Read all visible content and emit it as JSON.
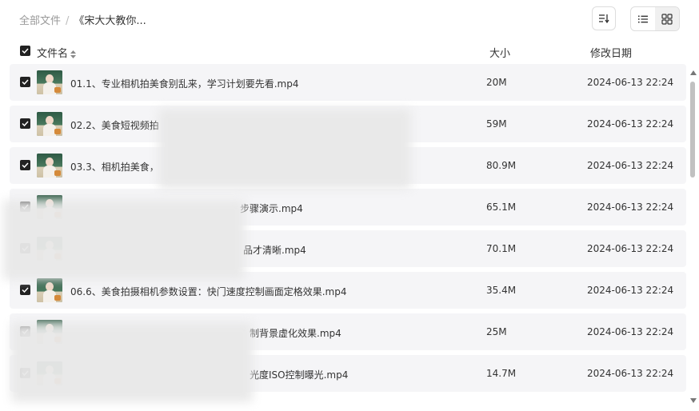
{
  "breadcrumb": {
    "root": "全部文件",
    "separator": "/",
    "current": "《宋大大教你..."
  },
  "header": {
    "name": "文件名",
    "size": "大小",
    "date": "修改日期"
  },
  "rows": [
    {
      "name": "01.1、专业相机拍美食别乱来，学习计划要先看.mp4",
      "size": "20M",
      "date": "2024-06-13 22:24"
    },
    {
      "name": "02.2、美食短视频拍",
      "size": "59M",
      "date": "2024-06-13 22:24"
    },
    {
      "name": "03.3、相机拍美食，",
      "size": "80.9M",
      "date": "2024-06-13 22:24"
    },
    {
      "name": "步骤演示.mp4",
      "size": "65.1M",
      "date": "2024-06-13 22:24"
    },
    {
      "name": "品才清晰.mp4",
      "size": "70.1M",
      "date": "2024-06-13 22:24"
    },
    {
      "name": "06.6、美食拍摄相机参数设置：快门速度控制画面定格效果.mp4",
      "size": "35.4M",
      "date": "2024-06-13 22:24"
    },
    {
      "name": "制背景虚化效果.mp4",
      "size": "25M",
      "date": "2024-06-13 22:24"
    },
    {
      "name": "光度ISO控制曝光.mp4",
      "size": "14.7M",
      "date": "2024-06-13 22:24"
    }
  ],
  "icons": {
    "sort": "sort-order-icon",
    "list_view": "list-view-icon",
    "grid_view": "grid-view-icon",
    "checkbox": "checkbox-checked-icon"
  },
  "colors": {
    "row_bg": "#f5f5f7",
    "checkbox": "#222222",
    "text": "#333333",
    "muted": "#999999"
  }
}
